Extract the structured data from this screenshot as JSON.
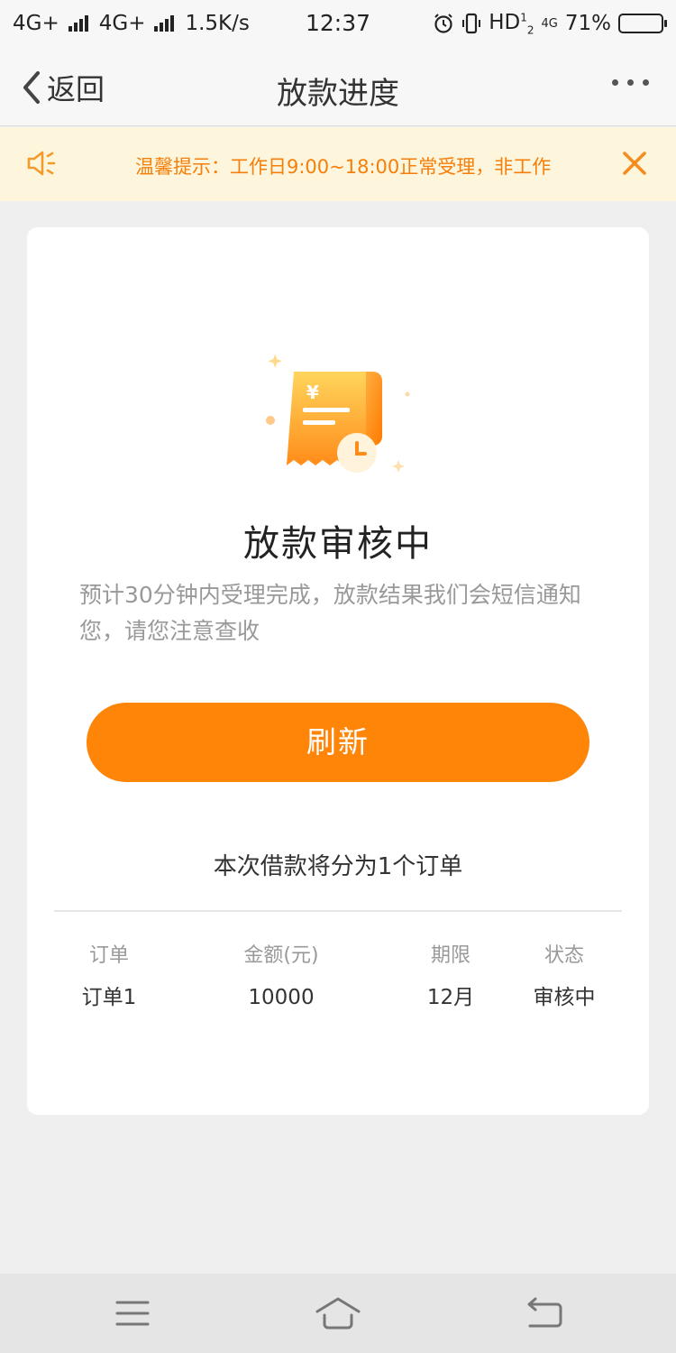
{
  "status_bar": {
    "carrier1": "4G+",
    "carrier2": "4G+",
    "speed": "1.5K/s",
    "time": "12:37",
    "hd": "HD",
    "net": "4G",
    "battery": "71%",
    "battery_level": 0.71
  },
  "nav": {
    "back_label": "返回",
    "title": "放款进度"
  },
  "notice": {
    "text": "温馨提示：工作日9:00~18:00正常受理，非工作"
  },
  "main": {
    "status_title": "放款审核中",
    "status_desc": "预计30分钟内受理完成，放款结果我们会短信通知您，请您注意查收",
    "refresh_label": "刷新",
    "split_text": "本次借款将分为1个订单",
    "table": {
      "headers": [
        "订单",
        "金额(元)",
        "期限",
        "状态"
      ],
      "rows": [
        [
          "订单1",
          "10000",
          "12月",
          "审核中"
        ]
      ]
    }
  },
  "colors": {
    "accent": "#ff8509",
    "notice_bg": "#fdf6dd",
    "notice_text": "#f57f0a"
  },
  "icons": {
    "back": "chevron-left-icon",
    "more": "more-dots-icon",
    "notice": "speaker-icon",
    "close": "close-icon",
    "illustration": "receipt-clock-icon",
    "sys_menu": "menu-icon",
    "sys_home": "home-icon",
    "sys_back": "return-icon"
  }
}
